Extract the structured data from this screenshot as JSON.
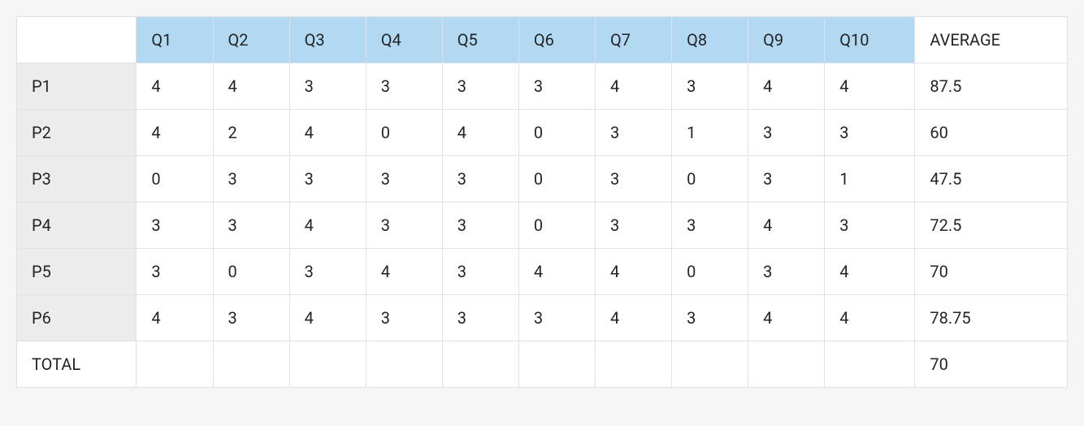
{
  "chart_data": {
    "type": "table",
    "columns": [
      "Q1",
      "Q2",
      "Q3",
      "Q4",
      "Q5",
      "Q6",
      "Q7",
      "Q8",
      "Q9",
      "Q10"
    ],
    "avg_label": "AVERAGE",
    "rows": [
      {
        "label": "P1",
        "values": [
          4,
          4,
          3,
          3,
          3,
          3,
          4,
          3,
          4,
          4
        ],
        "average": 87.5
      },
      {
        "label": "P2",
        "values": [
          4,
          2,
          4,
          0,
          4,
          0,
          3,
          1,
          3,
          3
        ],
        "average": 60
      },
      {
        "label": "P3",
        "values": [
          0,
          3,
          3,
          3,
          3,
          0,
          3,
          0,
          3,
          1
        ],
        "average": 47.5
      },
      {
        "label": "P4",
        "values": [
          3,
          3,
          4,
          3,
          3,
          0,
          3,
          3,
          4,
          3
        ],
        "average": 72.5
      },
      {
        "label": "P5",
        "values": [
          3,
          0,
          3,
          4,
          3,
          4,
          4,
          0,
          3,
          4
        ],
        "average": 70
      },
      {
        "label": "P6",
        "values": [
          4,
          3,
          4,
          3,
          3,
          3,
          4,
          3,
          4,
          4
        ],
        "average": 78.75
      }
    ],
    "total": {
      "label": "TOTAL",
      "average": 70
    }
  }
}
